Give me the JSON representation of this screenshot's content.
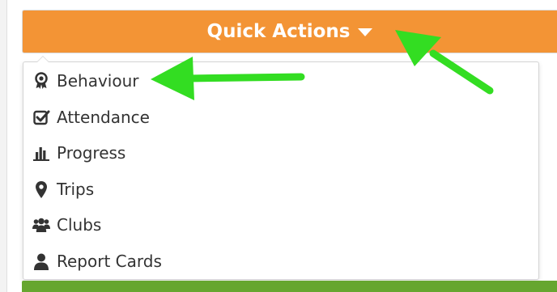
{
  "quick_actions": {
    "label": "Quick Actions",
    "caret_icon": "caret-down-icon",
    "color": "#f39435"
  },
  "menu": {
    "items": [
      {
        "label": "Behaviour",
        "icon": "award-icon"
      },
      {
        "label": "Attendance",
        "icon": "check-square-icon"
      },
      {
        "label": "Progress",
        "icon": "bar-chart-icon"
      },
      {
        "label": "Trips",
        "icon": "map-marker-icon"
      },
      {
        "label": "Clubs",
        "icon": "users-icon"
      },
      {
        "label": "Report Cards",
        "icon": "user-icon"
      }
    ]
  },
  "colors": {
    "accent_orange": "#f39435",
    "bar_green": "#66a62f",
    "annotation_arrow": "#33dd22"
  }
}
